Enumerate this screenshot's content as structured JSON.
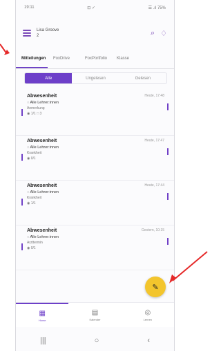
{
  "status": {
    "time": "19:11",
    "icons_left": "⊡ ✓",
    "icons_right": "☰ .ıl 75%"
  },
  "appbar": {
    "title_line1": "Lisa Groove",
    "title_line2": "2",
    "icons": [
      "search-icon",
      "bell-icon"
    ]
  },
  "tabs": [
    "Mitteilungen",
    "FoxDrive",
    "FoxPortfolio",
    "Klasse"
  ],
  "segments": [
    "Alle",
    "Ungelesen",
    "Gelesen"
  ],
  "messages": [
    {
      "subject": "Abwesenheit",
      "time": "Heute, 17:48",
      "recipient": "Alle Lehrer:innen",
      "detail": "Anmerkung",
      "meta": "1/1   □ 3"
    },
    {
      "subject": "Abwesenheit",
      "time": "Heute, 17:47",
      "recipient": "Alle Lehrer:innen",
      "detail": "Krankheit",
      "meta": "0/1"
    },
    {
      "subject": "Abwesenheit",
      "time": "Heute, 17:44",
      "recipient": "Alle Lehrer:innen",
      "detail": "Krankheit",
      "meta": "1/1"
    },
    {
      "subject": "Abwesenheit",
      "time": "Gestern, 10:15",
      "recipient": "Alle Lehrer:innen",
      "detail": "Arzttermin",
      "meta": "0/1"
    }
  ],
  "fab": {
    "icon": "edit-icon",
    "symbol": "✎"
  },
  "nav": [
    {
      "label": "Home",
      "symbol": "▦"
    },
    {
      "label": "Kalender",
      "symbol": "▤"
    },
    {
      "label": "Lernen",
      "symbol": "◎"
    }
  ],
  "sys": {
    "recent": "|||",
    "home": "○",
    "back": "‹"
  }
}
